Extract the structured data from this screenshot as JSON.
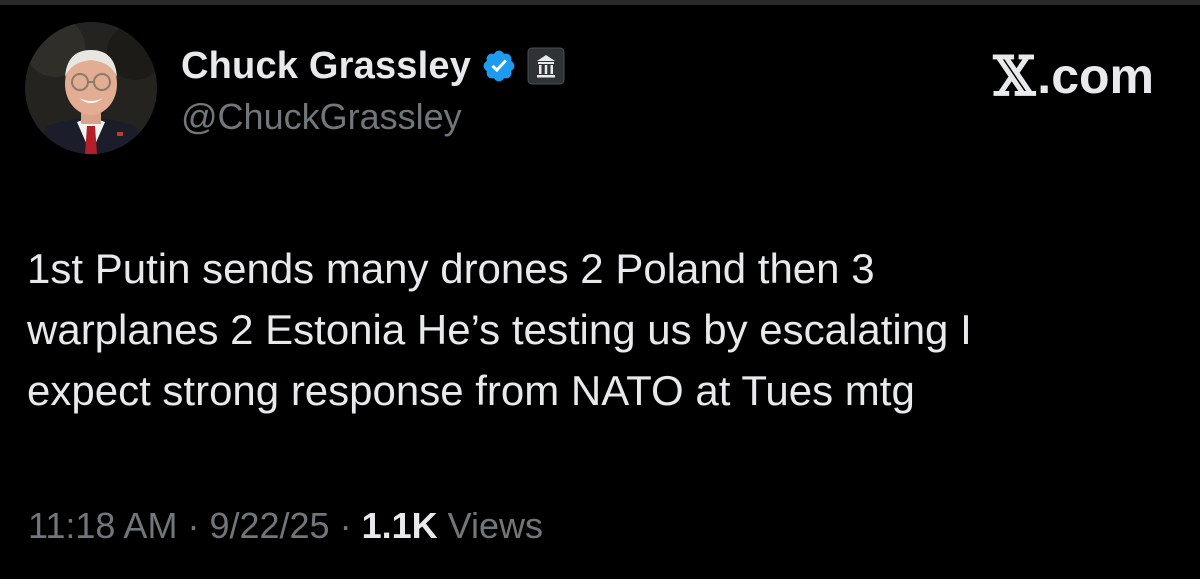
{
  "author": {
    "display_name": "Chuck Grassley",
    "handle": "@ChuckGrassley",
    "verified_icon": "verified-badge-icon",
    "affiliation_icon": "government-building-icon"
  },
  "watermark": {
    "x_glyph": "𝕏",
    "suffix": ".com"
  },
  "tweet": {
    "text": "1st Putin sends many drones 2 Poland then 3\nwarplanes 2 Estonia He’s testing us by escalating I\nexpect strong response from NATO at Tues mtg"
  },
  "meta": {
    "time": "11:18 AM",
    "separator": "·",
    "date": "9/22/25",
    "views_count": "1.1K",
    "views_label": "Views"
  },
  "colors": {
    "background": "#000000",
    "primary_text": "#e7e9ea",
    "secondary_text": "#71767b",
    "verified": "#1d9bf0"
  }
}
